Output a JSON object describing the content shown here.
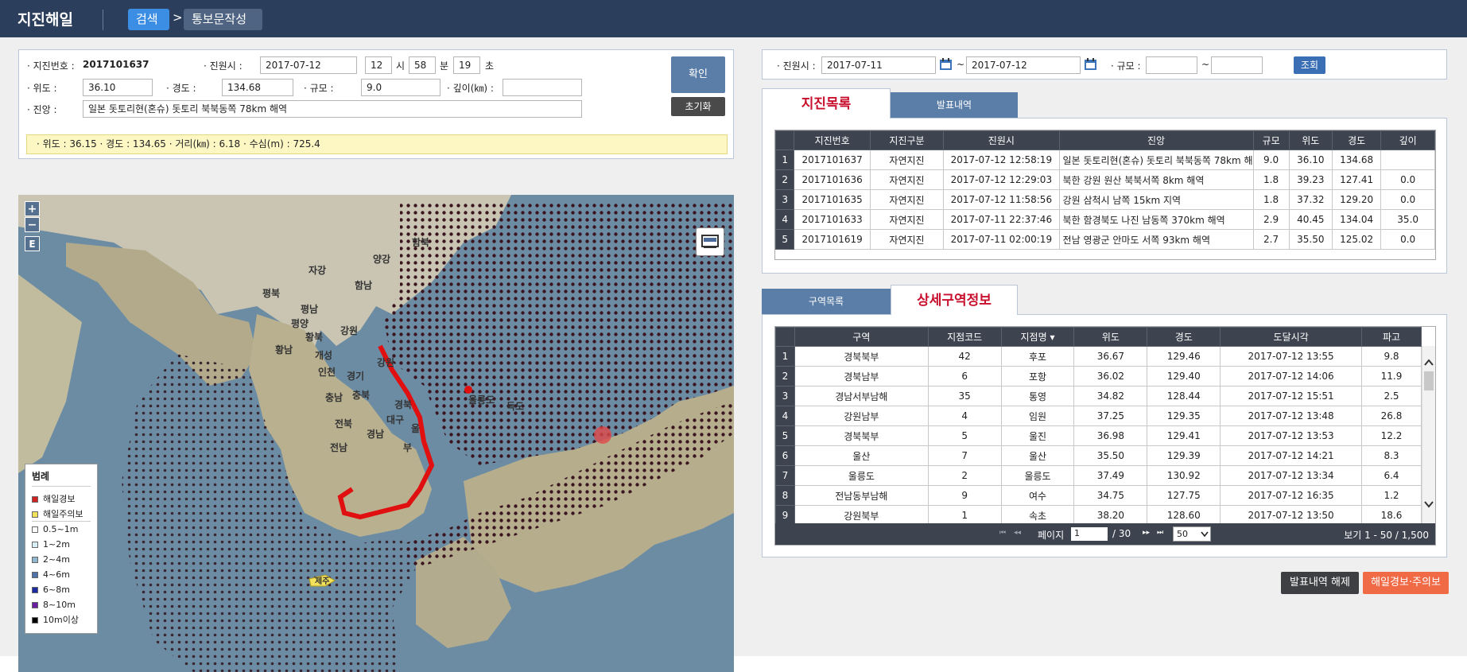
{
  "app": {
    "title": "지진해일",
    "crumb_search": "검색",
    "crumb_arrow": ">",
    "crumb_doc": "통보문작성"
  },
  "form": {
    "eq_no_label": "· 지진번호 :",
    "eq_no_value": "2017101637",
    "origin_time_label": "· 진원시 :",
    "origin_date": "2017-07-12",
    "hour": "12",
    "hour_unit": "시",
    "minute": "58",
    "minute_unit": "분",
    "second": "19",
    "second_unit": "초",
    "lat_label": "· 위도 :",
    "lat_value": "36.10",
    "lon_label": "· 경도 :",
    "lon_value": "134.68",
    "mag_label": "· 규모 :",
    "mag_value": "9.0",
    "depth_label": "· 깊이(㎞) :",
    "depth_value": "",
    "epicenter_label": "· 진앙 :",
    "epicenter_value": "일본 돗토리현(혼슈) 돗토리 북북동쪽 78km 해역",
    "confirm_btn": "확인",
    "reset_btn": "초기화",
    "info": "· 위도 : 36.15   · 경도 : 134.65   · 거리(㎞) : 6.18   · 수심(m) : 725.4"
  },
  "map": {
    "zoom_in": "+",
    "zoom_out": "−",
    "e_btn": "E",
    "labels": [
      {
        "text": "함북"
      },
      {
        "text": "양강"
      },
      {
        "text": "자강"
      },
      {
        "text": "함남"
      },
      {
        "text": "평북"
      },
      {
        "text": "평남"
      },
      {
        "text": "평양"
      },
      {
        "text": "강원"
      },
      {
        "text": "황북"
      },
      {
        "text": "황남"
      },
      {
        "text": "개성"
      },
      {
        "text": "인천"
      },
      {
        "text": "경기"
      },
      {
        "text": "강원"
      },
      {
        "text": "충남"
      },
      {
        "text": "충북"
      },
      {
        "text": "경북"
      },
      {
        "text": "대구"
      },
      {
        "text": "전북"
      },
      {
        "text": "경남"
      },
      {
        "text": "울"
      },
      {
        "text": "전남"
      },
      {
        "text": "부"
      },
      {
        "text": "제주"
      },
      {
        "text": "울릉도"
      },
      {
        "text": "독도"
      }
    ],
    "legend": {
      "title": "범례",
      "items": [
        {
          "label": "해일경보",
          "color": "#d32020"
        },
        {
          "label": "해일주의보",
          "color": "#f2e15a"
        },
        {
          "label": "0.5~1m",
          "color": "#ffffff"
        },
        {
          "label": "1~2m",
          "color": "#d7eef5"
        },
        {
          "label": "2~4m",
          "color": "#8fb7cf"
        },
        {
          "label": "4~6m",
          "color": "#4f73a9"
        },
        {
          "label": "6~8m",
          "color": "#1b2aa0"
        },
        {
          "label": "8~10m",
          "color": "#6a1fa0"
        },
        {
          "label": "10m이상",
          "color": "#000000"
        }
      ]
    }
  },
  "search": {
    "origin_label": "· 진원시 :",
    "date_from": "2017-07-11",
    "tilde": "~",
    "date_to": "2017-07-12",
    "mag_label": "· 규모 :",
    "mag_from": "",
    "mag_to": "",
    "query_btn": "조회"
  },
  "eq_tabs": {
    "active": "지진목록",
    "inactive": "발표내역"
  },
  "eq_table": {
    "headers": [
      "",
      "지진번호",
      "지진구분",
      "진원시",
      "진앙",
      "규모",
      "위도",
      "경도",
      "깊이"
    ],
    "rows": [
      [
        "1",
        "2017101637",
        "자연지진",
        "2017-07-12 12:58:19",
        "일본 돗토리현(혼슈) 돗토리 북북동쪽 78km 해",
        "9.0",
        "36.10",
        "134.68",
        ""
      ],
      [
        "2",
        "2017101636",
        "자연지진",
        "2017-07-12 12:29:03",
        "북한 강원 원산 북북서쪽 8km 해역",
        "1.8",
        "39.23",
        "127.41",
        "0.0"
      ],
      [
        "3",
        "2017101635",
        "자연지진",
        "2017-07-12 11:58:56",
        "강원 삼척시 남쪽 15km 지역",
        "1.8",
        "37.32",
        "129.20",
        "0.0"
      ],
      [
        "4",
        "2017101633",
        "자연지진",
        "2017-07-11 22:37:46",
        "북한 함경북도 나진 남동쪽 370km 해역",
        "2.9",
        "40.45",
        "134.04",
        "35.0"
      ],
      [
        "5",
        "2017101619",
        "자연지진",
        "2017-07-11 02:00:19",
        "전남 영광군 안마도 서쪽 93km 해역",
        "2.7",
        "35.50",
        "125.02",
        "0.0"
      ]
    ]
  },
  "zone_tabs": {
    "inactive": "구역목록",
    "active": "상세구역정보"
  },
  "zone_table": {
    "headers": [
      "",
      "구역",
      "지점코드",
      "지점명 ▾",
      "위도",
      "경도",
      "도달시각",
      "파고"
    ],
    "rows": [
      [
        "1",
        "경북북부",
        "42",
        "후포",
        "36.67",
        "129.46",
        "2017-07-12 13:55",
        "9.8"
      ],
      [
        "2",
        "경북남부",
        "6",
        "포항",
        "36.02",
        "129.40",
        "2017-07-12 14:06",
        "11.9"
      ],
      [
        "3",
        "경남서부남해",
        "35",
        "통영",
        "34.82",
        "128.44",
        "2017-07-12 15:51",
        "2.5"
      ],
      [
        "4",
        "강원남부",
        "4",
        "임원",
        "37.25",
        "129.35",
        "2017-07-12 13:48",
        "26.8"
      ],
      [
        "5",
        "경북북부",
        "5",
        "울진",
        "36.98",
        "129.41",
        "2017-07-12 13:53",
        "12.2"
      ],
      [
        "6",
        "울산",
        "7",
        "울산",
        "35.50",
        "129.39",
        "2017-07-12 14:21",
        "8.3"
      ],
      [
        "7",
        "울릉도",
        "2",
        "울릉도",
        "37.49",
        "130.92",
        "2017-07-12 13:34",
        "6.4"
      ],
      [
        "8",
        "전남동부남해",
        "9",
        "여수",
        "34.75",
        "127.75",
        "2017-07-12 16:35",
        "1.2"
      ],
      [
        "9",
        "강원북부",
        "1",
        "속초",
        "38.20",
        "128.60",
        "2017-07-12 13:50",
        "18.6"
      ]
    ],
    "pager": {
      "first": "⏮",
      "prev": "◂◂",
      "page_label": "페이지",
      "page_value": "1",
      "total_pages": "/ 30",
      "next": "▸▸",
      "last": "⏭",
      "page_size": "50",
      "view": "보기 1 - 50 / 1,500"
    }
  },
  "actions": {
    "release_btn": "발표내역 해제",
    "warning_btn": "해일경보·주의보"
  }
}
